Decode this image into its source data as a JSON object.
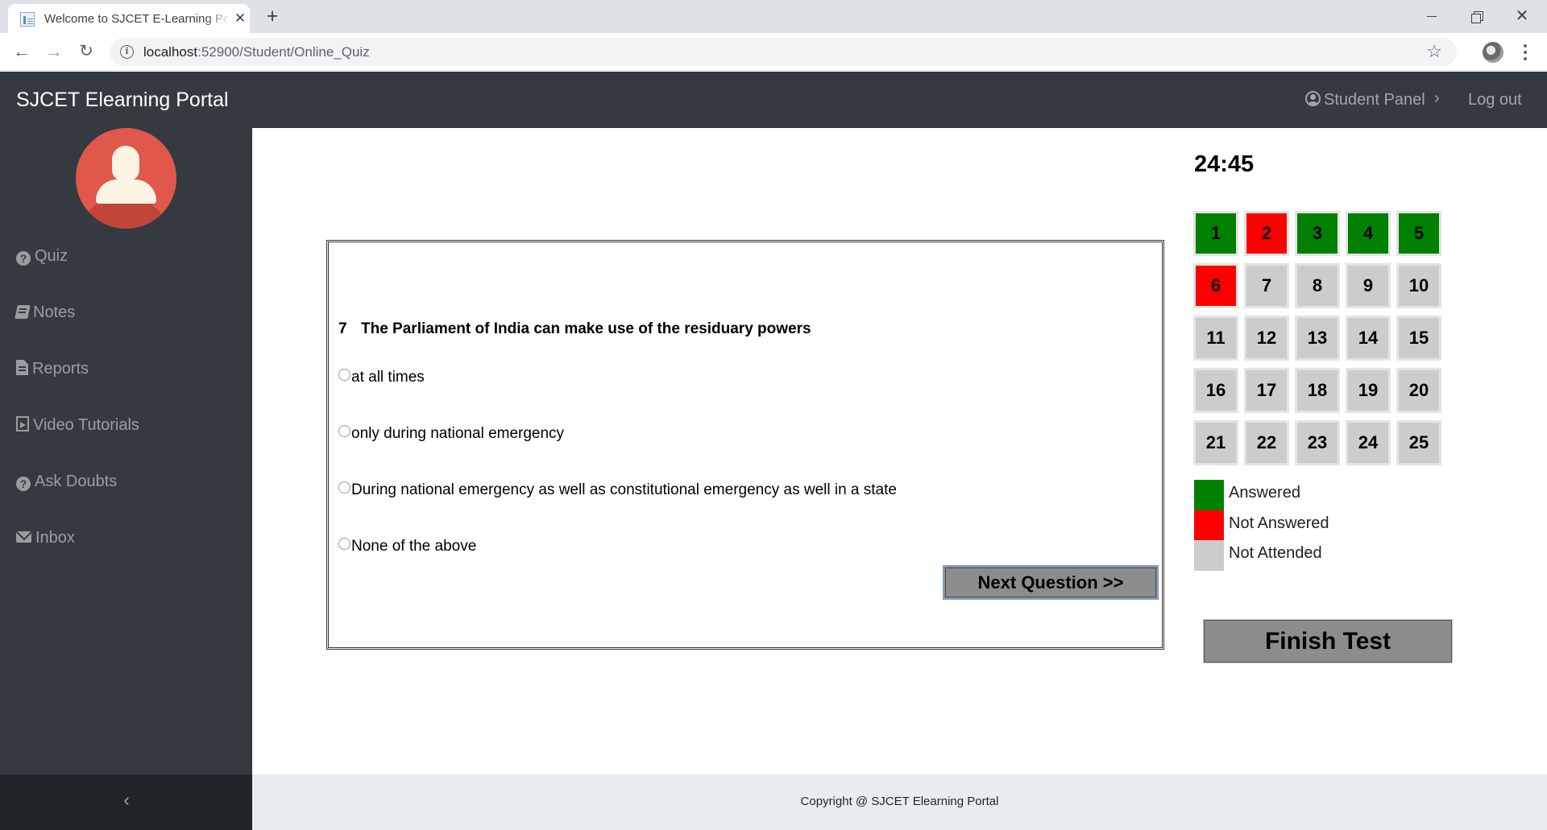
{
  "browser": {
    "tab_title": "Welcome to SJCET E-Learning Portal",
    "tab_close": "✕",
    "new_tab": "+",
    "url_host": "localhost",
    "url_rest": ":52900/Student/Online_Quiz",
    "win_close": "✕"
  },
  "header": {
    "brand": "SJCET Elearning Portal",
    "student_panel": "Student Panel",
    "chevron": "›",
    "logout": "Log out"
  },
  "sidebar": {
    "items": [
      {
        "label": "Quiz",
        "icon": "question-circle-icon"
      },
      {
        "label": "Notes",
        "icon": "book-icon"
      },
      {
        "label": "Reports",
        "icon": "file-text-icon"
      },
      {
        "label": "Video Tutorials",
        "icon": "file-video-icon"
      },
      {
        "label": "Ask Doubts",
        "icon": "question-circle-icon"
      },
      {
        "label": "Inbox",
        "icon": "envelope-icon"
      }
    ],
    "toggle": "‹"
  },
  "quiz": {
    "timer": "24:45",
    "question_number": "7",
    "question_text": "The Parliament of India can make use of the residuary powers",
    "options": [
      "at all times",
      "only during national emergency",
      "During national emergency as well as constitutional emergency as well in a state",
      "None of the above"
    ],
    "next_button": "Next Question >>",
    "finish_button": "Finish Test",
    "questions": [
      {
        "n": "1",
        "status": "answered"
      },
      {
        "n": "2",
        "status": "not-answered"
      },
      {
        "n": "3",
        "status": "answered"
      },
      {
        "n": "4",
        "status": "answered"
      },
      {
        "n": "5",
        "status": "answered"
      },
      {
        "n": "6",
        "status": "not-answered"
      },
      {
        "n": "7",
        "status": "not-attended"
      },
      {
        "n": "8",
        "status": "not-attended"
      },
      {
        "n": "9",
        "status": "not-attended"
      },
      {
        "n": "10",
        "status": "not-attended"
      },
      {
        "n": "11",
        "status": "not-attended"
      },
      {
        "n": "12",
        "status": "not-attended"
      },
      {
        "n": "13",
        "status": "not-attended"
      },
      {
        "n": "14",
        "status": "not-attended"
      },
      {
        "n": "15",
        "status": "not-attended"
      },
      {
        "n": "16",
        "status": "not-attended"
      },
      {
        "n": "17",
        "status": "not-attended"
      },
      {
        "n": "18",
        "status": "not-attended"
      },
      {
        "n": "19",
        "status": "not-attended"
      },
      {
        "n": "20",
        "status": "not-attended"
      },
      {
        "n": "21",
        "status": "not-attended"
      },
      {
        "n": "22",
        "status": "not-attended"
      },
      {
        "n": "23",
        "status": "not-attended"
      },
      {
        "n": "24",
        "status": "not-attended"
      },
      {
        "n": "25",
        "status": "not-attended"
      }
    ],
    "legend": [
      {
        "label": "Answered",
        "color": "#008000"
      },
      {
        "label": "Not Answered",
        "color": "#ff0000"
      },
      {
        "label": "Not Attended",
        "color": "#cccccc"
      }
    ]
  },
  "footer": {
    "copyright": "Copyright @ SJCET Elearning Portal"
  }
}
